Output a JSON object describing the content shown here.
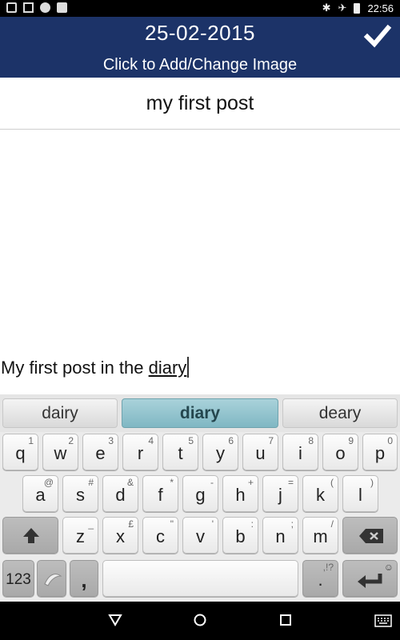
{
  "status_bar": {
    "time": "22:56",
    "icons": [
      "screenshot-icon",
      "image-icon",
      "badge-icon",
      "checklist-icon",
      "bluetooth-icon",
      "airplane-icon",
      "battery-icon"
    ]
  },
  "header": {
    "date": "25-02-2015",
    "subtitle": "Click to Add/Change Image",
    "background": "#1c3368"
  },
  "post": {
    "title": "my first post",
    "body_prefix": "My first post in the ",
    "body_word": "diary"
  },
  "keyboard": {
    "suggestions": [
      "dairy",
      "diary",
      "deary"
    ],
    "row1": [
      {
        "main": "q",
        "sup": "1"
      },
      {
        "main": "w",
        "sup": "2"
      },
      {
        "main": "e",
        "sup": "3"
      },
      {
        "main": "r",
        "sup": "4"
      },
      {
        "main": "t",
        "sup": "5"
      },
      {
        "main": "y",
        "sup": "6"
      },
      {
        "main": "u",
        "sup": "7"
      },
      {
        "main": "i",
        "sup": "8"
      },
      {
        "main": "o",
        "sup": "9"
      },
      {
        "main": "p",
        "sup": "0"
      }
    ],
    "row2": [
      {
        "main": "a",
        "sup": "@"
      },
      {
        "main": "s",
        "sup": "#"
      },
      {
        "main": "d",
        "sup": "&"
      },
      {
        "main": "f",
        "sup": "*"
      },
      {
        "main": "g",
        "sup": "-"
      },
      {
        "main": "h",
        "sup": "+"
      },
      {
        "main": "j",
        "sup": "="
      },
      {
        "main": "k",
        "sup": "("
      },
      {
        "main": "l",
        "sup": ")"
      }
    ],
    "row3": [
      {
        "main": "z",
        "sup": "_"
      },
      {
        "main": "x",
        "sup": "£"
      },
      {
        "main": "c",
        "sup": "\""
      },
      {
        "main": "v",
        "sup": "'"
      },
      {
        "main": "b",
        "sup": ":"
      },
      {
        "main": "n",
        "sup": ";"
      },
      {
        "main": "m",
        "sup": "/"
      }
    ],
    "numbers_label": "123",
    "comma": ",",
    "period": ".",
    "period_sup": ",!?",
    "accent": "#7fb7c3"
  }
}
